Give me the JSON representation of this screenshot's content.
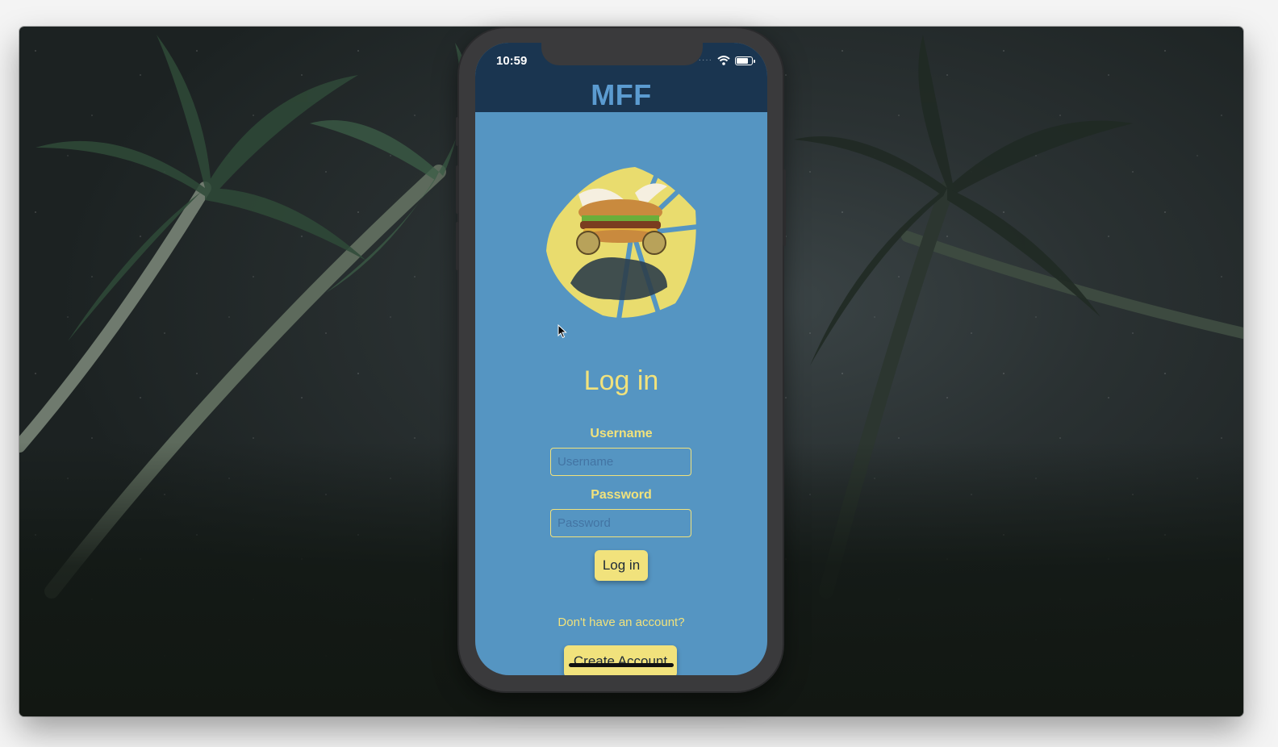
{
  "status_bar": {
    "time": "10:59",
    "signal_icon": "signal-dots-icon",
    "wifi_icon": "wifi-icon",
    "battery_icon": "battery-icon"
  },
  "header": {
    "title": "MFF"
  },
  "login": {
    "heading": "Log in",
    "username_label": "Username",
    "username_placeholder": "Username",
    "username_value": "",
    "password_label": "Password",
    "password_placeholder": "Password",
    "password_value": "",
    "submit_label": "Log in",
    "no_account_text": "Don't have an account?",
    "create_account_label": "Create Account"
  },
  "colors": {
    "screen_bg": "#5595c2",
    "header_bg": "#1a3550",
    "title_color": "#5b9bd0",
    "accent_yellow": "#f1e27c",
    "phone_frame": "#3a3a3c"
  }
}
